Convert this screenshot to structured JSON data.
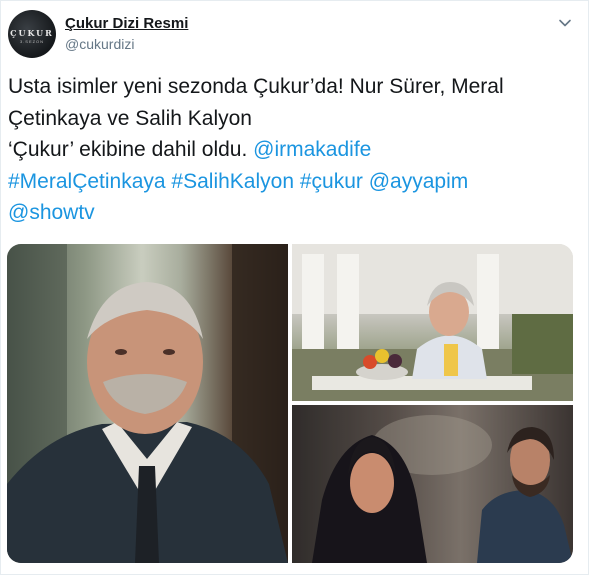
{
  "account": {
    "display_name": "Çukur Dizi Resmi",
    "handle": "@cukurdizi",
    "avatar_text": "ÇUKUR",
    "avatar_subtext": "3.SEZON"
  },
  "tweet": {
    "line1": "Usta isimler yeni sezonda Çukur’da! Nur Sürer, Meral",
    "line2": "Çetinkaya ve Salih Kalyon",
    "line3_text": "‘Çukur’ ekibine dahil oldu.  ",
    "mention_irmak": "@irmakadife",
    "tag_meral": "#MeralÇetinkaya",
    "tag_salih": "#SalihKalyon",
    "tag_cukur": "#çukur",
    "mention_ayyapim": "@ayyapim",
    "mention_showtv": "@showtv"
  },
  "colors": {
    "link": "#1b95e0",
    "text": "#14171a",
    "muted": "#657786"
  },
  "icons": {
    "caret": "chevron-down-icon"
  }
}
